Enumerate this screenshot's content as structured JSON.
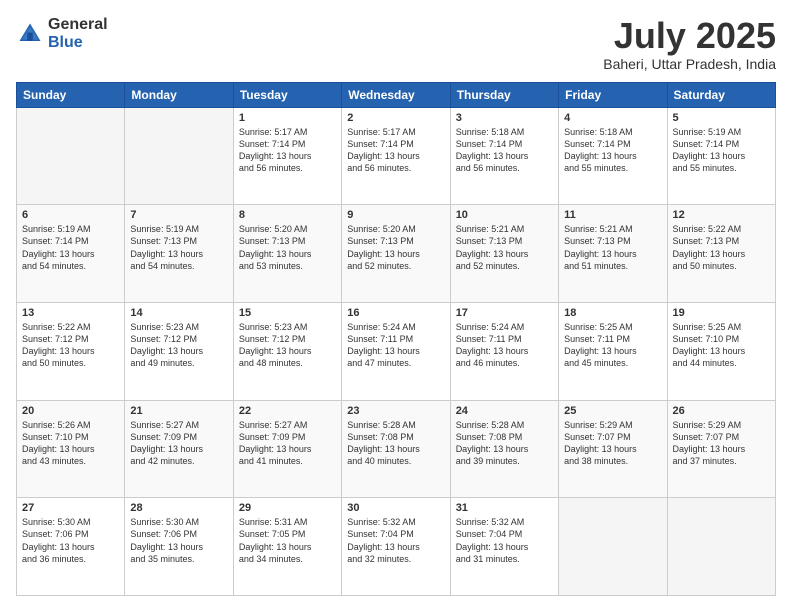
{
  "logo": {
    "line1": "General",
    "line2": "Blue"
  },
  "title": "July 2025",
  "location": "Baheri, Uttar Pradesh, India",
  "days_of_week": [
    "Sunday",
    "Monday",
    "Tuesday",
    "Wednesday",
    "Thursday",
    "Friday",
    "Saturday"
  ],
  "weeks": [
    [
      {
        "day": "",
        "info": ""
      },
      {
        "day": "",
        "info": ""
      },
      {
        "day": "1",
        "info": "Sunrise: 5:17 AM\nSunset: 7:14 PM\nDaylight: 13 hours\nand 56 minutes."
      },
      {
        "day": "2",
        "info": "Sunrise: 5:17 AM\nSunset: 7:14 PM\nDaylight: 13 hours\nand 56 minutes."
      },
      {
        "day": "3",
        "info": "Sunrise: 5:18 AM\nSunset: 7:14 PM\nDaylight: 13 hours\nand 56 minutes."
      },
      {
        "day": "4",
        "info": "Sunrise: 5:18 AM\nSunset: 7:14 PM\nDaylight: 13 hours\nand 55 minutes."
      },
      {
        "day": "5",
        "info": "Sunrise: 5:19 AM\nSunset: 7:14 PM\nDaylight: 13 hours\nand 55 minutes."
      }
    ],
    [
      {
        "day": "6",
        "info": "Sunrise: 5:19 AM\nSunset: 7:14 PM\nDaylight: 13 hours\nand 54 minutes."
      },
      {
        "day": "7",
        "info": "Sunrise: 5:19 AM\nSunset: 7:13 PM\nDaylight: 13 hours\nand 54 minutes."
      },
      {
        "day": "8",
        "info": "Sunrise: 5:20 AM\nSunset: 7:13 PM\nDaylight: 13 hours\nand 53 minutes."
      },
      {
        "day": "9",
        "info": "Sunrise: 5:20 AM\nSunset: 7:13 PM\nDaylight: 13 hours\nand 52 minutes."
      },
      {
        "day": "10",
        "info": "Sunrise: 5:21 AM\nSunset: 7:13 PM\nDaylight: 13 hours\nand 52 minutes."
      },
      {
        "day": "11",
        "info": "Sunrise: 5:21 AM\nSunset: 7:13 PM\nDaylight: 13 hours\nand 51 minutes."
      },
      {
        "day": "12",
        "info": "Sunrise: 5:22 AM\nSunset: 7:13 PM\nDaylight: 13 hours\nand 50 minutes."
      }
    ],
    [
      {
        "day": "13",
        "info": "Sunrise: 5:22 AM\nSunset: 7:12 PM\nDaylight: 13 hours\nand 50 minutes."
      },
      {
        "day": "14",
        "info": "Sunrise: 5:23 AM\nSunset: 7:12 PM\nDaylight: 13 hours\nand 49 minutes."
      },
      {
        "day": "15",
        "info": "Sunrise: 5:23 AM\nSunset: 7:12 PM\nDaylight: 13 hours\nand 48 minutes."
      },
      {
        "day": "16",
        "info": "Sunrise: 5:24 AM\nSunset: 7:11 PM\nDaylight: 13 hours\nand 47 minutes."
      },
      {
        "day": "17",
        "info": "Sunrise: 5:24 AM\nSunset: 7:11 PM\nDaylight: 13 hours\nand 46 minutes."
      },
      {
        "day": "18",
        "info": "Sunrise: 5:25 AM\nSunset: 7:11 PM\nDaylight: 13 hours\nand 45 minutes."
      },
      {
        "day": "19",
        "info": "Sunrise: 5:25 AM\nSunset: 7:10 PM\nDaylight: 13 hours\nand 44 minutes."
      }
    ],
    [
      {
        "day": "20",
        "info": "Sunrise: 5:26 AM\nSunset: 7:10 PM\nDaylight: 13 hours\nand 43 minutes."
      },
      {
        "day": "21",
        "info": "Sunrise: 5:27 AM\nSunset: 7:09 PM\nDaylight: 13 hours\nand 42 minutes."
      },
      {
        "day": "22",
        "info": "Sunrise: 5:27 AM\nSunset: 7:09 PM\nDaylight: 13 hours\nand 41 minutes."
      },
      {
        "day": "23",
        "info": "Sunrise: 5:28 AM\nSunset: 7:08 PM\nDaylight: 13 hours\nand 40 minutes."
      },
      {
        "day": "24",
        "info": "Sunrise: 5:28 AM\nSunset: 7:08 PM\nDaylight: 13 hours\nand 39 minutes."
      },
      {
        "day": "25",
        "info": "Sunrise: 5:29 AM\nSunset: 7:07 PM\nDaylight: 13 hours\nand 38 minutes."
      },
      {
        "day": "26",
        "info": "Sunrise: 5:29 AM\nSunset: 7:07 PM\nDaylight: 13 hours\nand 37 minutes."
      }
    ],
    [
      {
        "day": "27",
        "info": "Sunrise: 5:30 AM\nSunset: 7:06 PM\nDaylight: 13 hours\nand 36 minutes."
      },
      {
        "day": "28",
        "info": "Sunrise: 5:30 AM\nSunset: 7:06 PM\nDaylight: 13 hours\nand 35 minutes."
      },
      {
        "day": "29",
        "info": "Sunrise: 5:31 AM\nSunset: 7:05 PM\nDaylight: 13 hours\nand 34 minutes."
      },
      {
        "day": "30",
        "info": "Sunrise: 5:32 AM\nSunset: 7:04 PM\nDaylight: 13 hours\nand 32 minutes."
      },
      {
        "day": "31",
        "info": "Sunrise: 5:32 AM\nSunset: 7:04 PM\nDaylight: 13 hours\nand 31 minutes."
      },
      {
        "day": "",
        "info": ""
      },
      {
        "day": "",
        "info": ""
      }
    ]
  ]
}
